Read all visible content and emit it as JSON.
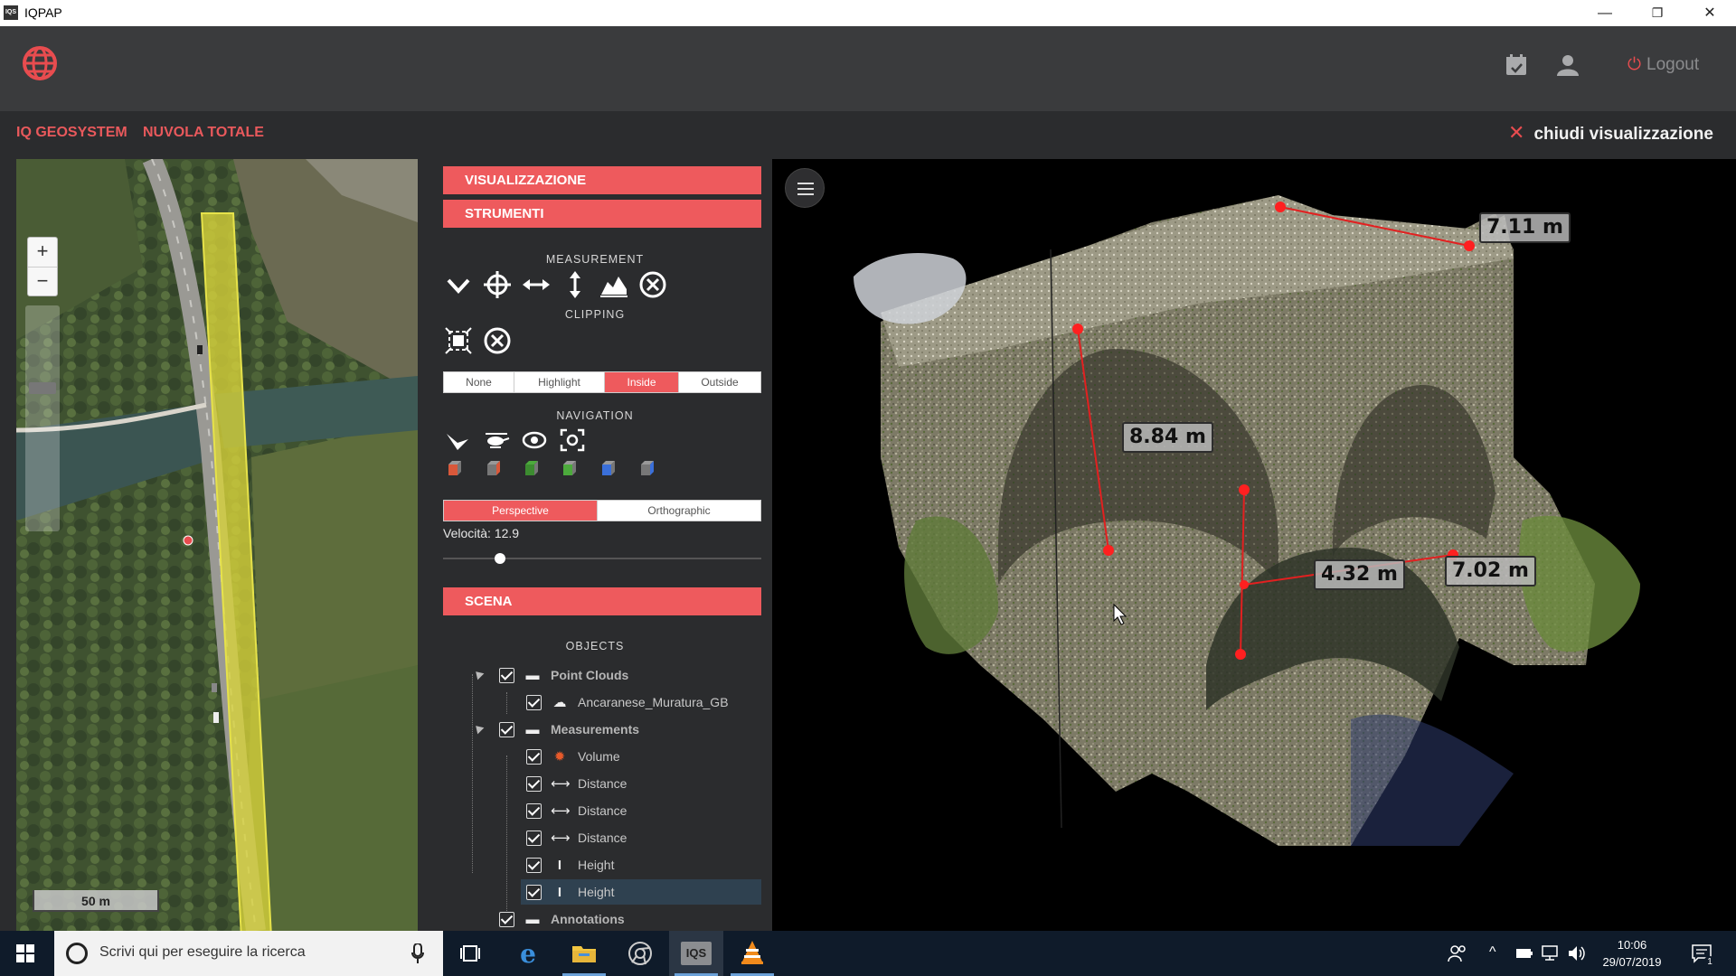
{
  "window": {
    "app_icon_text": "IQS",
    "title": "IQPAP",
    "minimize": "—",
    "maximize": "❐",
    "close": "✕"
  },
  "header": {
    "logout_label": "Logout",
    "icons": [
      "globe-logo-icon",
      "calendar-check-icon",
      "user-icon",
      "power-icon"
    ]
  },
  "breadcrumb": {
    "items": [
      "IQ GEOSYSTEM",
      "NUVOLA TOTALE"
    ],
    "close_view_label": "chiudi visualizzazione"
  },
  "map": {
    "zoom_in": "+",
    "zoom_out": "−",
    "scale_label": "50 m",
    "colors": {
      "selection": "#d8d43a",
      "marker": "#e84c4f"
    }
  },
  "sidebar": {
    "sections": {
      "visualizzazione": "VISUALIZZAZIONE",
      "strumenti": "STRUMENTI",
      "scena": "SCENA"
    },
    "measurement_label": "MEASUREMENT",
    "measurement_tools": [
      "angle-icon",
      "point-icon",
      "distance-icon",
      "height-icon",
      "profile-icon",
      "remove-all-icon"
    ],
    "clipping_label": "CLIPPING",
    "clipping_tools": [
      "clip-volume-icon",
      "remove-clip-icon"
    ],
    "clip_modes": {
      "options": [
        "None",
        "Highlight",
        "Inside",
        "Outside"
      ],
      "selected": "Inside"
    },
    "navigation_label": "NAVIGATION",
    "navigation_tools": [
      "fly-control-icon",
      "helicopter-control-icon",
      "orbit-control-icon",
      "focus-icon"
    ],
    "view_cubes": [
      "left-view-icon",
      "front-view-icon",
      "top-view-icon",
      "bottom-view-icon",
      "right-view-icon",
      "back-view-icon"
    ],
    "projection": {
      "options": [
        "Perspective",
        "Orthographic"
      ],
      "selected": "Perspective"
    },
    "speed_label": "Velocità: 12.9",
    "speed_fraction": 0.18,
    "objects_label": "OBJECTS",
    "tree": [
      {
        "label": "Point Clouds",
        "level": 0,
        "icon": "folder-icon",
        "group": true
      },
      {
        "label": "Ancaranese_Muratura_GB",
        "level": 1,
        "icon": "cloud-icon"
      },
      {
        "label": "Measurements",
        "level": 0,
        "icon": "folder-icon",
        "group": true
      },
      {
        "label": "Volume",
        "level": 1,
        "icon": "volume-icon"
      },
      {
        "label": "Distance",
        "level": 1,
        "icon": "distance-icon"
      },
      {
        "label": "Distance",
        "level": 1,
        "icon": "distance-icon"
      },
      {
        "label": "Distance",
        "level": 1,
        "icon": "distance-icon"
      },
      {
        "label": "Height",
        "level": 1,
        "icon": "height-icon"
      },
      {
        "label": "Height",
        "level": 1,
        "icon": "height-icon",
        "selected": true
      },
      {
        "label": "Annotations",
        "level": 0,
        "icon": "folder-icon",
        "group": true
      }
    ]
  },
  "viewer": {
    "measurements": [
      "7.11 m",
      "8.84 m",
      "4.32 m",
      "7.02 m"
    ],
    "colors": {
      "measure_line": "#e22020",
      "accent": "#ee5a5d"
    }
  },
  "taskbar": {
    "search_placeholder": "Scrivi qui per eseguire la ricerca",
    "apps": [
      "task-view-icon",
      "edge-icon",
      "file-explorer-icon",
      "chrome-icon",
      "iqs-app-icon",
      "vlc-icon"
    ],
    "time": "10:06",
    "date": "29/07/2019",
    "notification_count": "1"
  }
}
